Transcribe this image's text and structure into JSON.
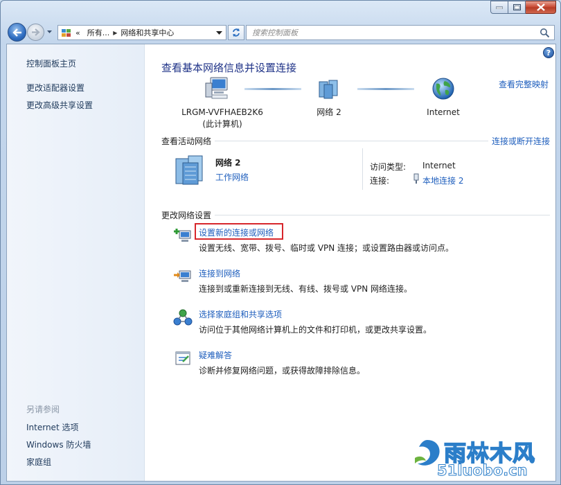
{
  "address_bar": {
    "segments": [
      "所有...",
      "网络和共享中心"
    ],
    "overflow_label": "«"
  },
  "search": {
    "placeholder": "搜索控制面板"
  },
  "sidebar": {
    "top_links": [
      "控制面板主页",
      "更改适配器设置",
      "更改高级共享设置"
    ],
    "see_also_label": "另请参阅",
    "see_also_links": [
      "Internet 选项",
      "Windows 防火墙",
      "家庭组"
    ]
  },
  "main": {
    "title": "查看基本网络信息并设置连接",
    "full_map_link": "查看完整映射",
    "map": {
      "computer_name": "LRGM-VVFHAEB2K6",
      "computer_note": "(此计算机)",
      "network_name": "网络  2",
      "internet_label": "Internet"
    },
    "active_networks": {
      "title": "查看活动网络",
      "connect_link": "连接或断开连接",
      "network_name": "网络  2",
      "network_type": "工作网络",
      "access_type_label": "访问类型:",
      "access_type_value": "Internet",
      "connection_label": "连接:",
      "connection_value": "本地连接 2"
    },
    "change_settings": {
      "title": "更改网络设置",
      "tasks": [
        {
          "title": "设置新的连接或网络",
          "desc": "设置无线、宽带、拨号、临时或 VPN 连接；或设置路由器或访问点。",
          "icon": "new-connection-icon"
        },
        {
          "title": "连接到网络",
          "desc": "连接到或重新连接到无线、有线、拨号或 VPN 网络连接。",
          "icon": "connect-network-icon"
        },
        {
          "title": "选择家庭组和共享选项",
          "desc": "访问位于其他网络计算机上的文件和打印机，或更改共享设置。",
          "icon": "homegroup-icon"
        },
        {
          "title": "疑难解答",
          "desc": "诊断并修复网络问题，或获得故障排除信息。",
          "icon": "troubleshoot-icon"
        }
      ]
    }
  },
  "watermark": {
    "brand": "雨林木风",
    "site": "51luobo.cn"
  },
  "colors": {
    "link": "#1e5ebd",
    "title": "#1e3287",
    "highlight": "#d7262b"
  }
}
